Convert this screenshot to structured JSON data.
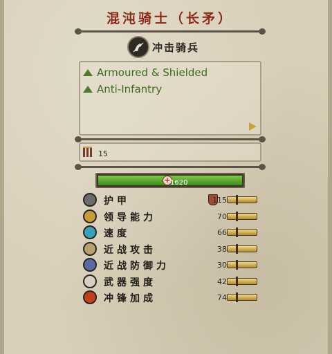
{
  "unit": {
    "name": "混沌骑士（长矛）",
    "class_label": "冲击骑兵",
    "class_icon": "horse-head-icon"
  },
  "attributes": [
    {
      "label": "Armoured & Shielded",
      "icon": "green-triangle-icon"
    },
    {
      "label": "Anti-Infantry",
      "icon": "green-triangle-icon"
    }
  ],
  "soldiers": {
    "count": "15",
    "icon": "soldiers-icon"
  },
  "health": {
    "value": "1620",
    "fill_fraction": 1.0,
    "icon": "health-cross-icon"
  },
  "stats": [
    {
      "name": "护甲",
      "value": "115",
      "icon": "armour-icon",
      "color": "#6b6b6b"
    },
    {
      "name": "领导能力",
      "value": "70",
      "icon": "leadership-icon",
      "color": "#c79a3a"
    },
    {
      "name": "速度",
      "value": "66",
      "icon": "speed-icon",
      "color": "#3aa0b8"
    },
    {
      "name": "近战攻击",
      "value": "38",
      "icon": "melee-attack-icon",
      "color": "#b8a070"
    },
    {
      "name": "近战防御力",
      "value": "30",
      "icon": "melee-defence-icon",
      "color": "#5a6aa0"
    },
    {
      "name": "武器强度",
      "value": "42",
      "icon": "weapon-strength-icon",
      "color": "#d8d0c0"
    },
    {
      "name": "冲锋加成",
      "value": "74",
      "icon": "charge-bonus-icon",
      "color": "#c04020"
    }
  ],
  "colors": {
    "title": "#8a2a1a",
    "attribute_text": "#3d6a20",
    "health_bar": "#5fae33",
    "stat_bar": "#d9b75c"
  }
}
